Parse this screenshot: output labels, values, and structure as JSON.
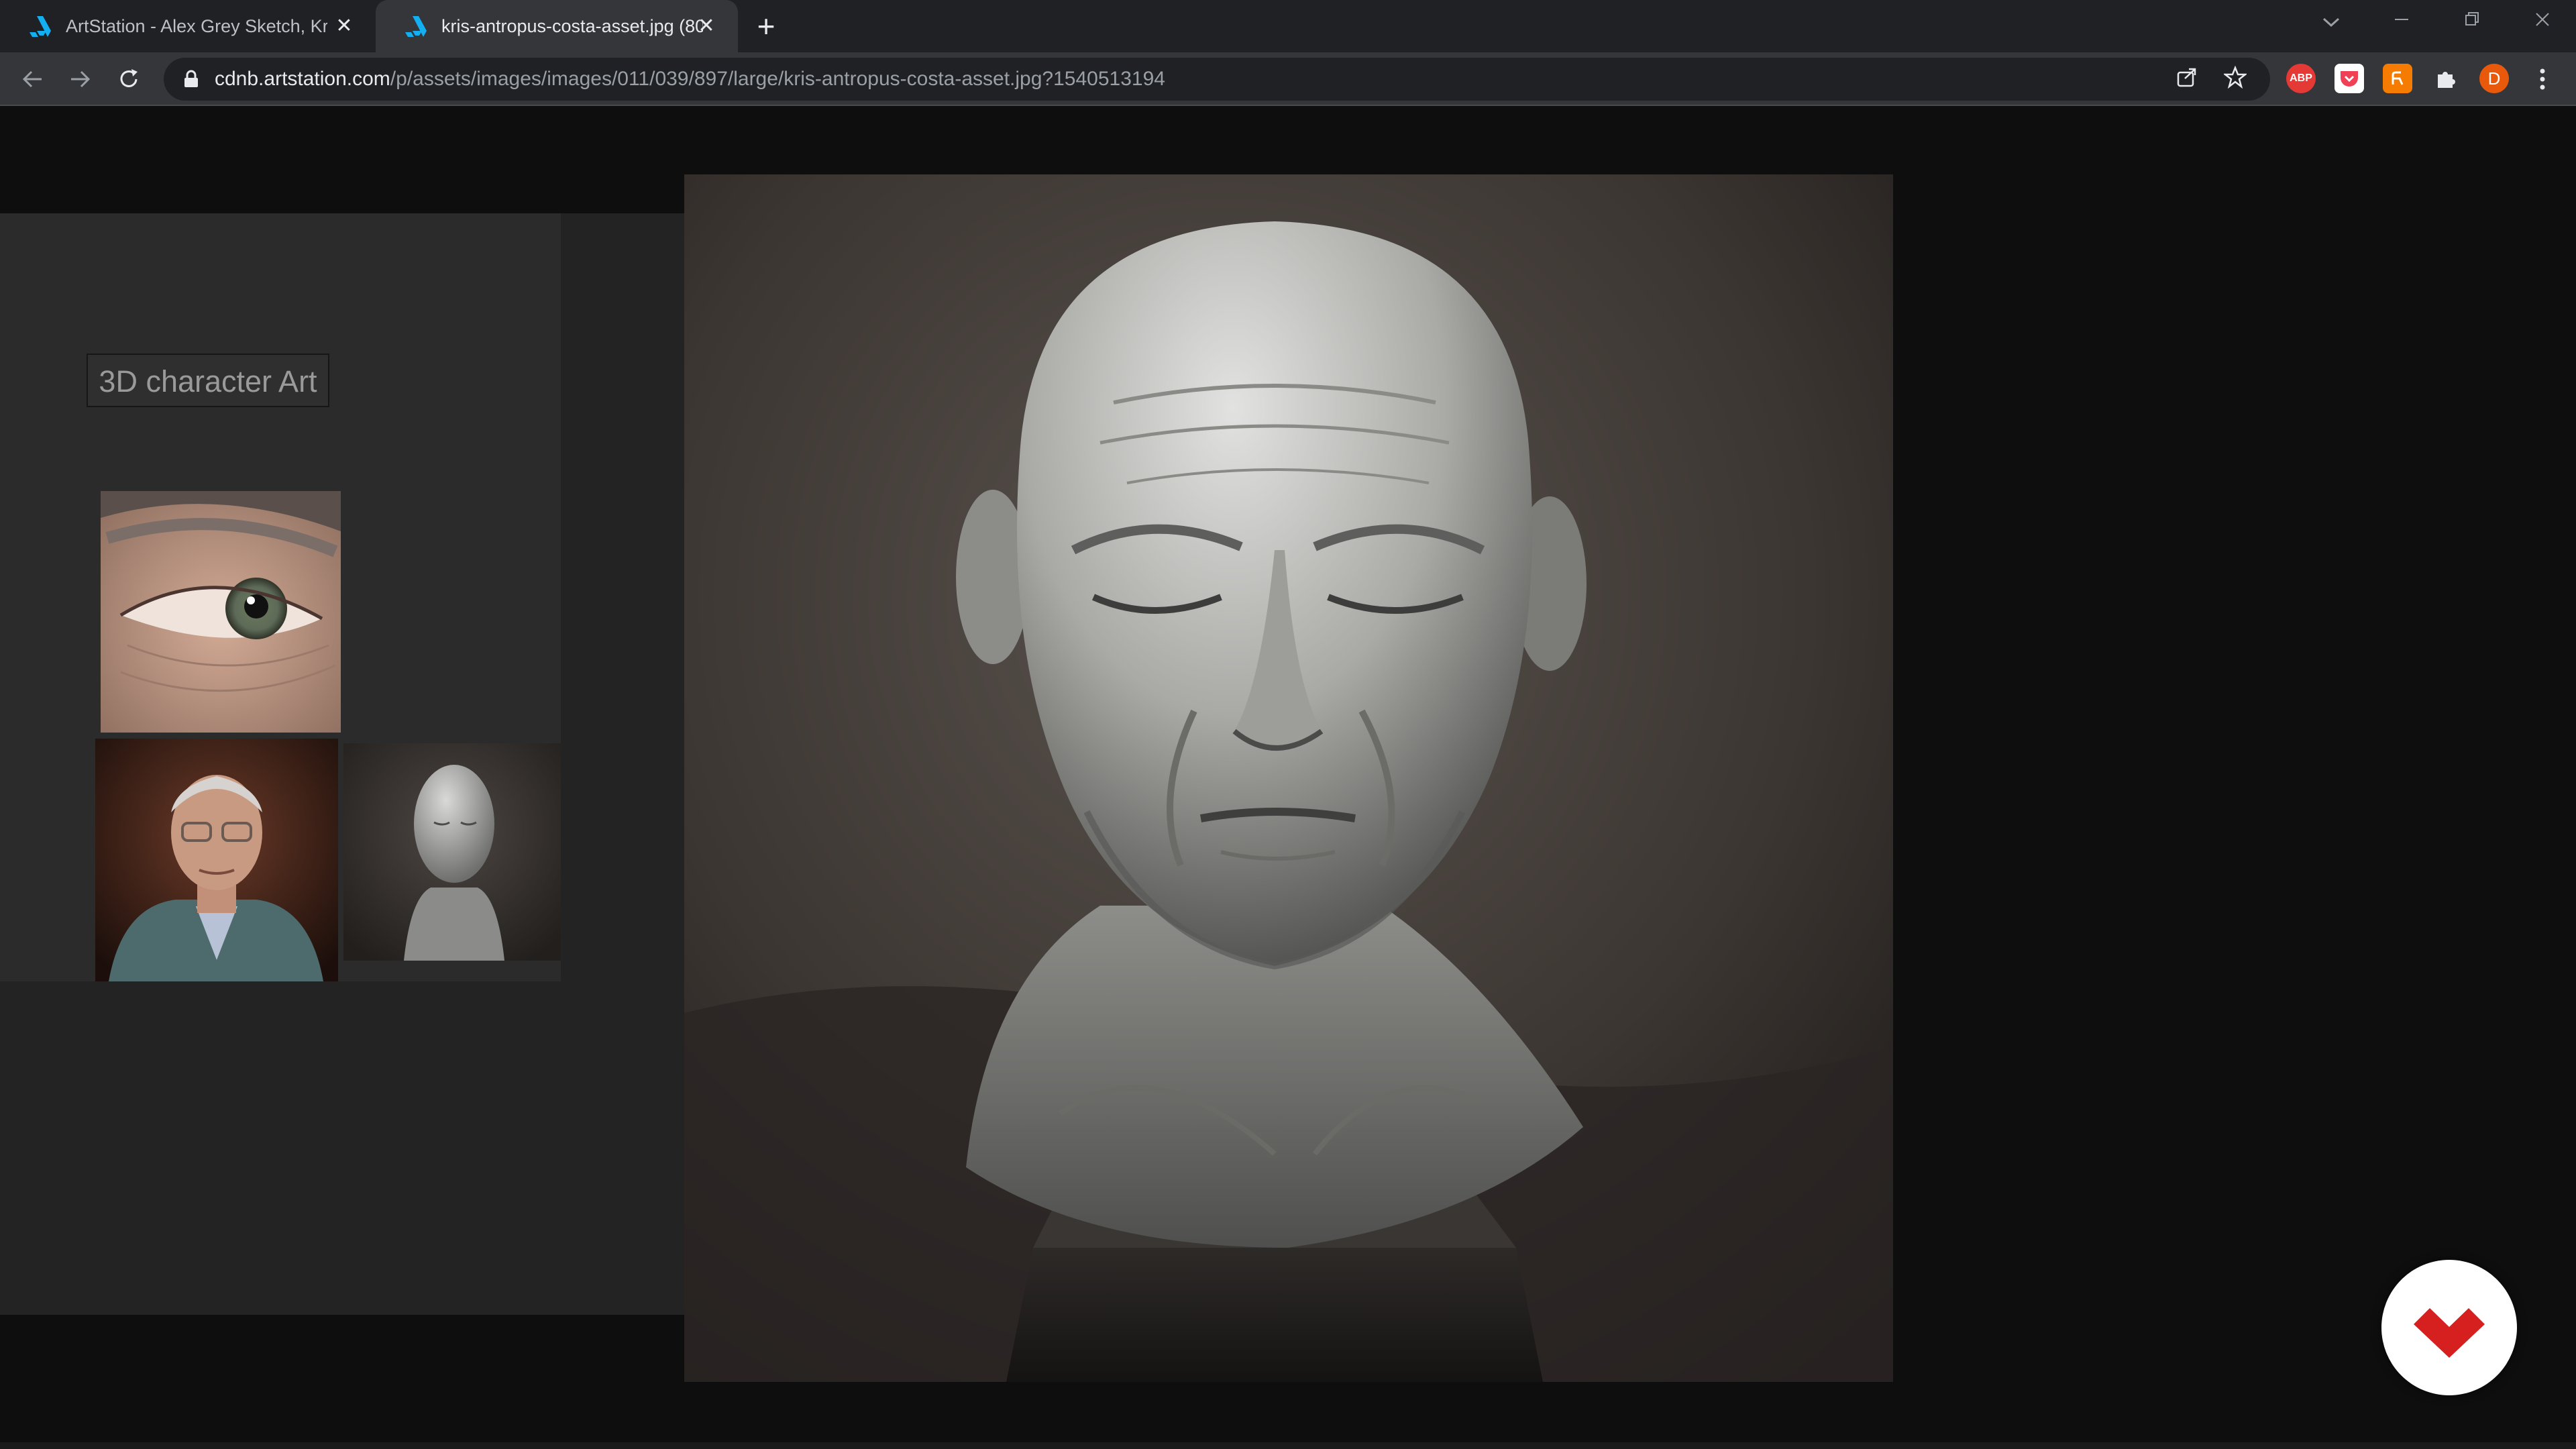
{
  "browser": {
    "tabs": [
      {
        "title": "ArtStation - Alex Grey Sketch, Kri",
        "active": false,
        "favicon": "artstation-icon"
      },
      {
        "title": "kris-antropus-costa-asset.jpg (80",
        "active": true,
        "favicon": "artstation-icon"
      }
    ],
    "new_tab_label": "+",
    "close_label": "✕",
    "address": {
      "host": "cdnb.artstation.com",
      "path": "/p/assets/images/images/011/039/897/large/kris-antropus-costa-asset.jpg?1540513194"
    },
    "profile_initial": "D",
    "extensions": [
      {
        "name": "adblock-plus-icon",
        "text": "ABP",
        "color": "#e53935"
      },
      {
        "name": "pocket-icon",
        "text": "",
        "color": "#ef4056"
      },
      {
        "name": "extension-orange-icon",
        "text": "",
        "color": "#f57c00"
      },
      {
        "name": "puzzle-icon",
        "text": "",
        "color": "#e8eaed"
      }
    ]
  },
  "board": {
    "label": "3D character Art"
  },
  "colors": {
    "chrome_dark": "#202124",
    "chrome_tab": "#35363a",
    "page_bg": "#0e0e0e",
    "brand_red": "#d6201f",
    "profile_orange": "#e8590c"
  }
}
